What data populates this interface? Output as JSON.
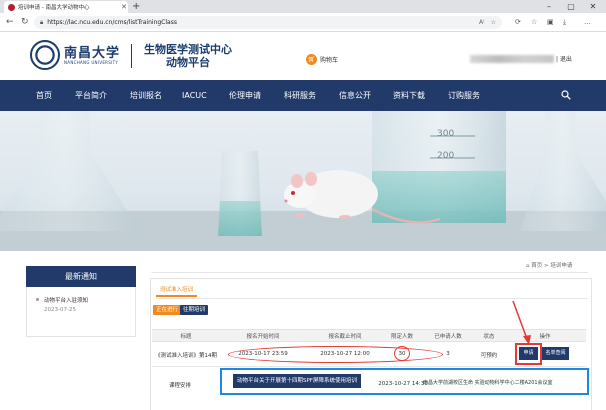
{
  "browser": {
    "tab_title": "培训申请 - 南昌大学动物中心",
    "url": "https://lac.ncu.edu.cn/cms/listTrainingClass",
    "url_display": "https://lac.ncu.edu.cn/cms/listTrainingClass",
    "reader_label": "A⁽"
  },
  "header": {
    "university_name": "南昌大学",
    "university_sub": "NANCHANG UNIVERSITY",
    "center_title_line1": "生物医学测试中心",
    "center_title_line2": "动物平台",
    "cart_label": "购物车",
    "logout_label": "| 退出"
  },
  "nav": {
    "items": [
      "首页",
      "平台简介",
      "培训报名",
      "IACUC",
      "伦理申请",
      "科研服务",
      "信息公开",
      "资料下载",
      "订购服务"
    ]
  },
  "banner": {
    "beaker_marks": [
      "300",
      "200"
    ]
  },
  "sidebar": {
    "title": "最新通知",
    "notice_title": "动物平台入驻须知",
    "notice_date": "2023-07-25"
  },
  "breadcrumb": {
    "home": "首页",
    "sep": ">",
    "current": "培训申请"
  },
  "content": {
    "tab_label": "测试准入培训",
    "filter_ongoing": "正在进行",
    "filter_past": "往期培训",
    "table": {
      "headers": [
        "标题",
        "报名开始时间",
        "报名截止时间",
        "限定人数",
        "已申请人数",
        "状态",
        "操作"
      ],
      "rows": [
        {
          "title": "《测试准入培训》第14期",
          "start": "2023-10-17 23:59",
          "end": "2023-10-27 12:00",
          "limit": "30",
          "applied": "3",
          "status": "可预约",
          "apply_label": "申请",
          "list_label": "名单查阅"
        }
      ]
    },
    "course": {
      "label": "课程安排",
      "name": "动物平台关于开展第十四期SPF屏障系统使用培训",
      "time": "2023-10-27 14:30",
      "location": "南昌大学前湖校区生命 实验动物科学中心二楼A201会议室"
    }
  },
  "colors": {
    "nav_bg": "#213a6a",
    "accent_orange": "#f08a1c",
    "highlight_red": "#e53935",
    "highlight_blue": "#1e88e5"
  }
}
